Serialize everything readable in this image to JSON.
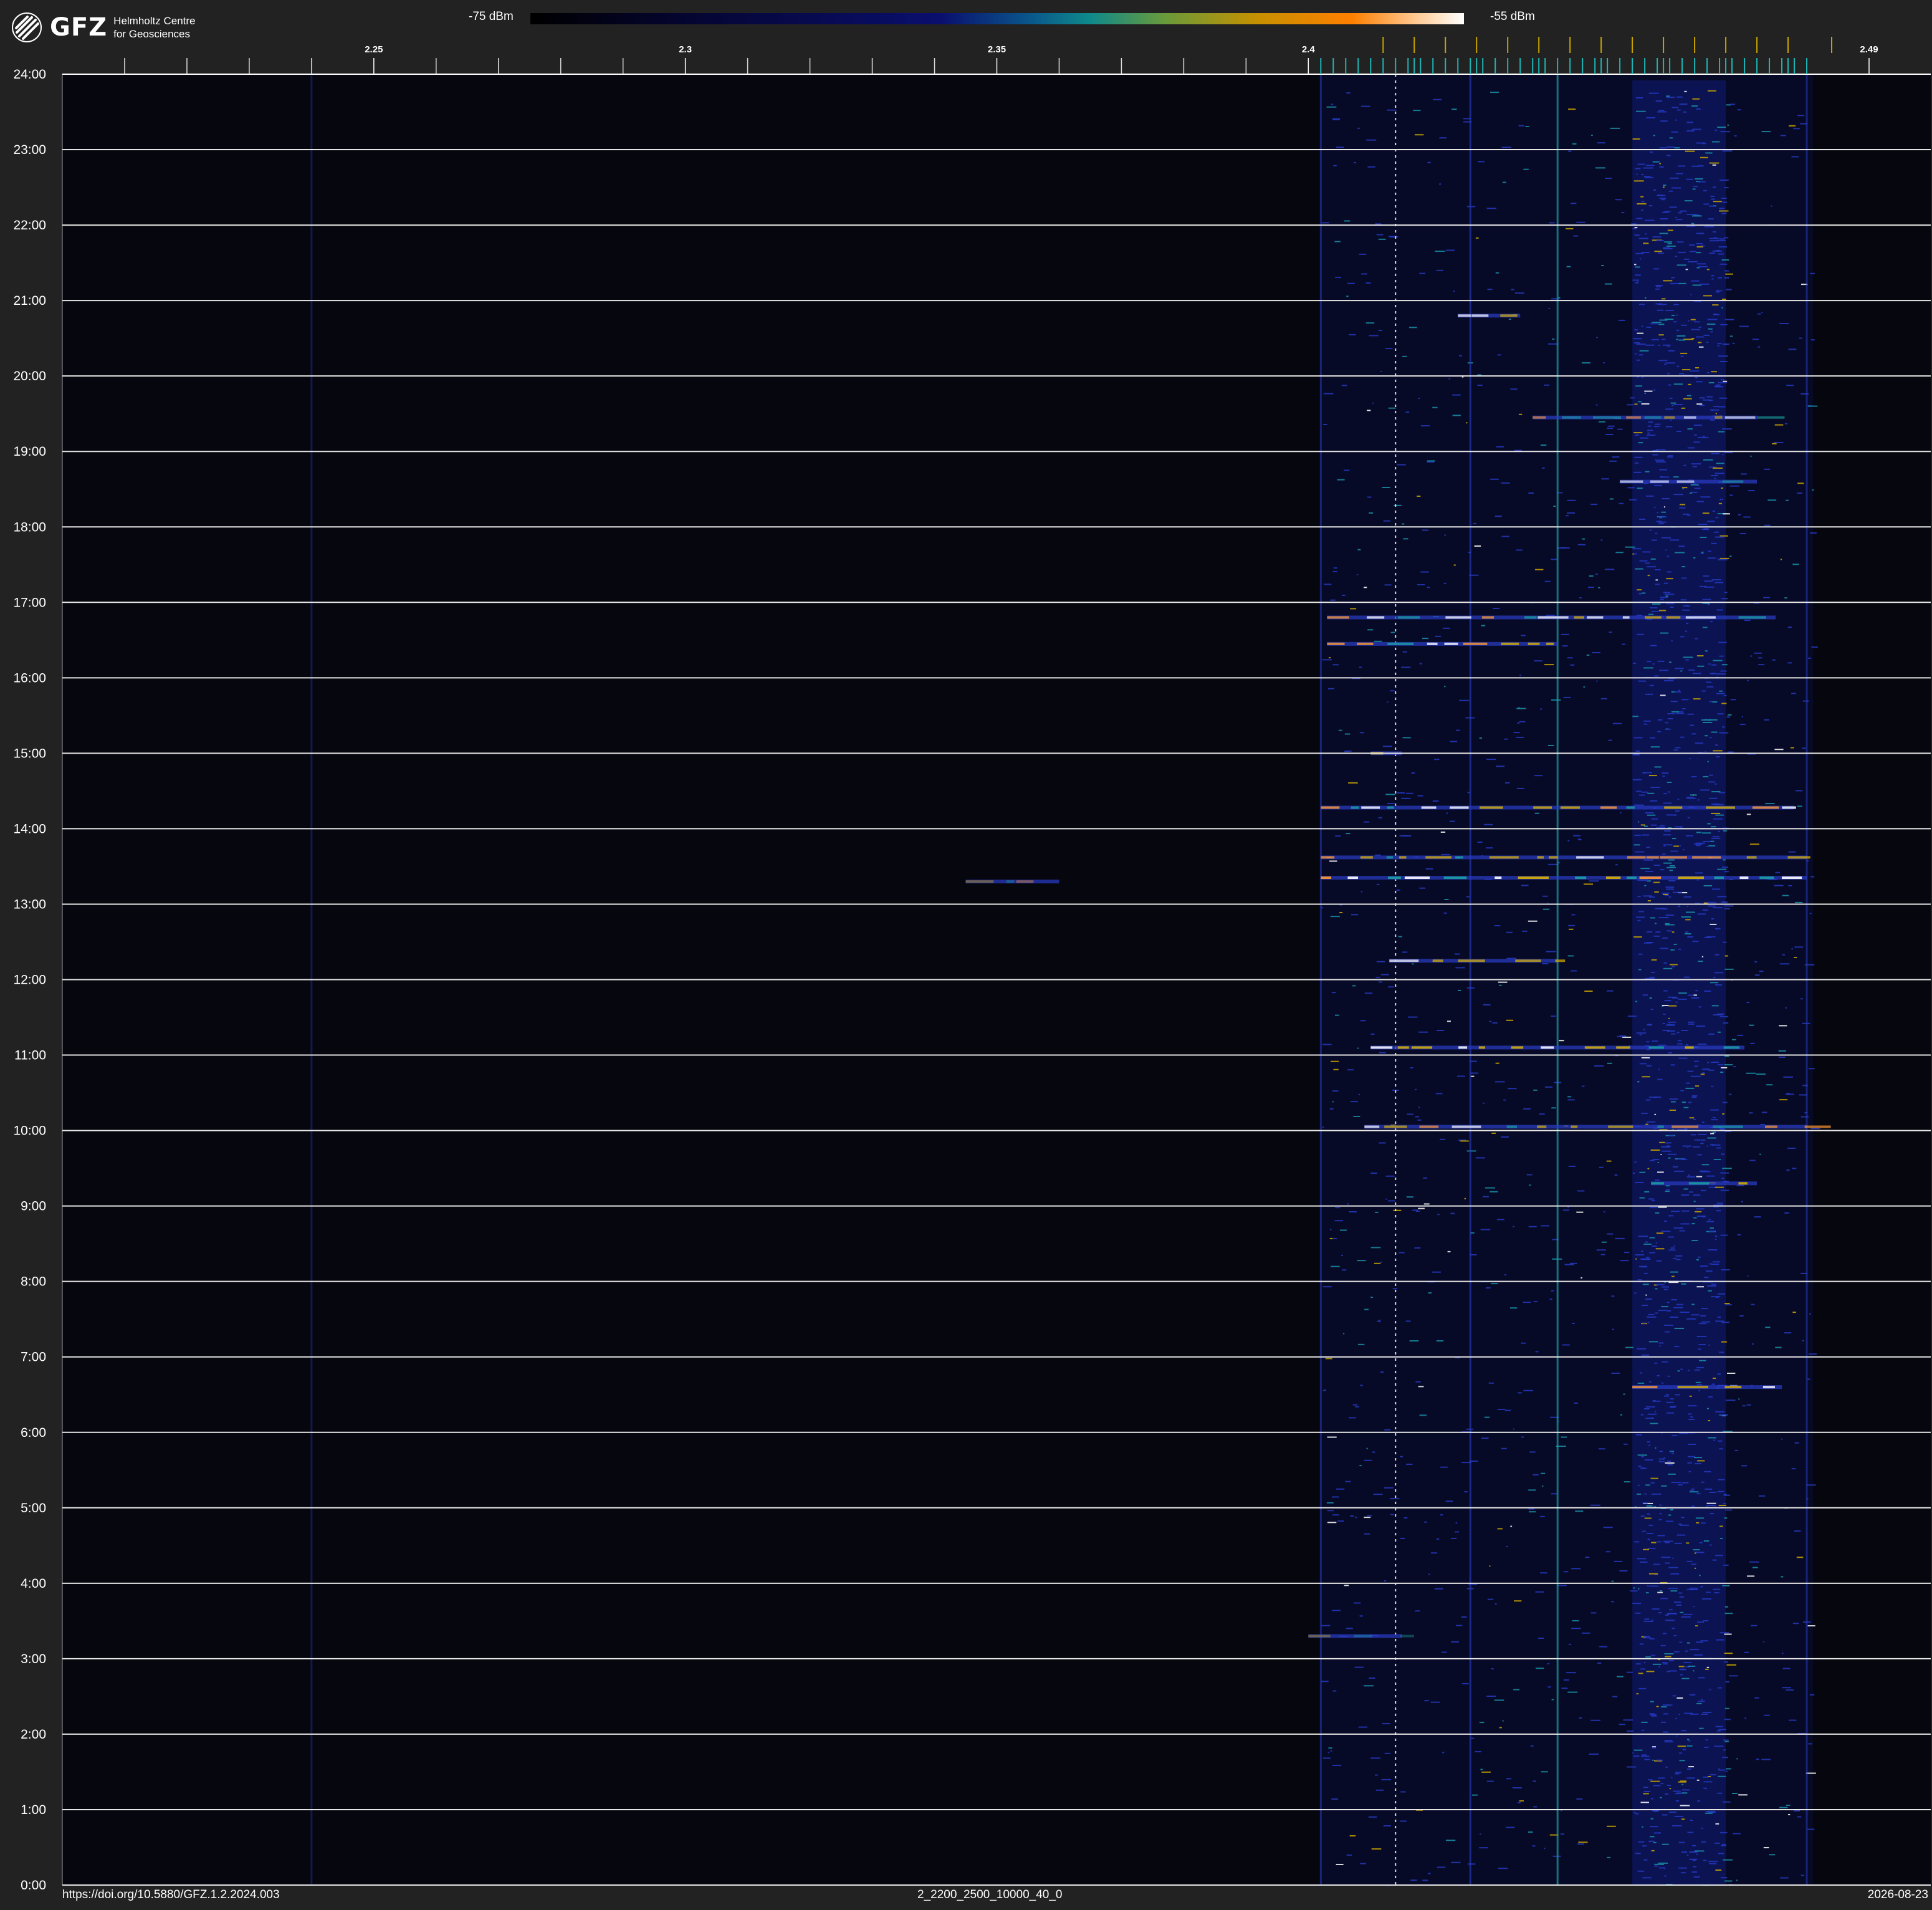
{
  "header": {
    "logo_text": "GFZ",
    "logo_subtitle_line1": "Helmholtz Centre",
    "logo_subtitle_line2": "for Geosciences",
    "colorbar_min_label": "-75 dBm",
    "colorbar_max_label": "-55 dBm"
  },
  "footer": {
    "doi": "https://doi.org/10.5880/GFZ.1.2.2024.003",
    "config_id": "2_2200_2500_10000_40_0",
    "date": "2026-08-23"
  },
  "colors": {
    "background": "#222222",
    "plot_background": "#06060f",
    "gridline": "#e6e6e6",
    "signal_blue": "#2a3cc8",
    "signal_teal": "#1aa0a0",
    "signal_yellow": "#d8b000",
    "signal_white": "#ffffff",
    "marker_teal": "#1fb5b5",
    "marker_gold": "#c8a400"
  },
  "chart_data": {
    "type": "heatmap",
    "title": "",
    "xlabel": "",
    "ylabel": "",
    "colorbar": {
      "min": -75,
      "max": -55,
      "unit": "dBm"
    },
    "xlim": [
      2.2,
      2.49
    ],
    "ylim": [
      0,
      24
    ],
    "x_tick_labels": [
      {
        "value": 2.25,
        "label": "2.25"
      },
      {
        "value": 2.3,
        "label": "2.3"
      },
      {
        "value": 2.35,
        "label": "2.35"
      },
      {
        "value": 2.4,
        "label": "2.4"
      },
      {
        "value": 2.49,
        "label": "2.49"
      }
    ],
    "x_minor_ticks": [
      2.21,
      2.22,
      2.23,
      2.24,
      2.26,
      2.27,
      2.28,
      2.29,
      2.31,
      2.32,
      2.33,
      2.34,
      2.36,
      2.37,
      2.38,
      2.39
    ],
    "y_tick_labels": [
      "0:00",
      "1:00",
      "2:00",
      "3:00",
      "4:00",
      "5:00",
      "6:00",
      "7:00",
      "8:00",
      "9:00",
      "10:00",
      "11:00",
      "12:00",
      "13:00",
      "14:00",
      "15:00",
      "16:00",
      "17:00",
      "18:00",
      "19:00",
      "20:00",
      "21:00",
      "22:00",
      "23:00",
      "24:00"
    ],
    "grid": true,
    "wifi_channel_markers_ghz": [
      2.412,
      2.417,
      2.422,
      2.427,
      2.432,
      2.437,
      2.442,
      2.447,
      2.452,
      2.457,
      2.462,
      2.467,
      2.472,
      2.477
    ],
    "wifi_band_markers_ghz": [
      2.402,
      2.404,
      2.406,
      2.408,
      2.41,
      2.414,
      2.416,
      2.418,
      2.42,
      2.424,
      2.426,
      2.428,
      2.43,
      2.434,
      2.436,
      2.438,
      2.44,
      2.444,
      2.446,
      2.448,
      2.45,
      2.454,
      2.456,
      2.458,
      2.46,
      2.464,
      2.466,
      2.468,
      2.47,
      2.474,
      2.476,
      2.478,
      2.48
    ],
    "gold_markers_ghz": [
      2.412,
      2.417,
      2.422,
      2.427,
      2.432,
      2.437,
      2.442,
      2.447,
      2.452,
      2.457,
      2.462,
      2.467,
      2.472,
      2.477,
      2.484
    ],
    "persistent_lines": [
      {
        "freq": 2.24,
        "intensity": 0.35,
        "color": "blue"
      },
      {
        "freq": 2.402,
        "intensity": 0.55,
        "color": "blue"
      },
      {
        "freq": 2.414,
        "intensity": 0.85,
        "color": "white"
      },
      {
        "freq": 2.426,
        "intensity": 0.6,
        "color": "blue"
      },
      {
        "freq": 2.44,
        "intensity": 0.7,
        "color": "teal"
      },
      {
        "freq": 2.48,
        "intensity": 0.5,
        "color": "blue"
      }
    ],
    "active_band": {
      "from": 2.402,
      "to": 2.481,
      "core_from": 2.452,
      "core_to": 2.467
    },
    "bursts": [
      {
        "t": 13.35,
        "from": 2.402,
        "to": 2.48,
        "level": 0.9
      },
      {
        "t": 13.62,
        "from": 2.402,
        "to": 2.48,
        "level": 0.75
      },
      {
        "t": 14.28,
        "from": 2.402,
        "to": 2.478,
        "level": 0.8
      },
      {
        "t": 16.45,
        "from": 2.403,
        "to": 2.44,
        "level": 0.8
      },
      {
        "t": 16.8,
        "from": 2.403,
        "to": 2.475,
        "level": 0.75
      },
      {
        "t": 19.45,
        "from": 2.436,
        "to": 2.472,
        "level": 0.6
      },
      {
        "t": 11.1,
        "from": 2.41,
        "to": 2.47,
        "level": 0.85
      },
      {
        "t": 10.05,
        "from": 2.409,
        "to": 2.48,
        "level": 0.7
      },
      {
        "t": 9.3,
        "from": 2.455,
        "to": 2.472,
        "level": 0.85
      },
      {
        "t": 6.6,
        "from": 2.452,
        "to": 2.476,
        "level": 0.8
      },
      {
        "t": 12.25,
        "from": 2.413,
        "to": 2.44,
        "level": 0.7
      },
      {
        "t": 15.0,
        "from": 2.41,
        "to": 2.415,
        "level": 0.8
      },
      {
        "t": 13.3,
        "from": 2.345,
        "to": 2.36,
        "level": 0.4
      },
      {
        "t": 3.3,
        "from": 2.4,
        "to": 2.415,
        "level": 0.4
      },
      {
        "t": 18.6,
        "from": 2.45,
        "to": 2.472,
        "level": 0.6
      },
      {
        "t": 20.8,
        "from": 2.424,
        "to": 2.434,
        "level": 0.7
      }
    ]
  }
}
